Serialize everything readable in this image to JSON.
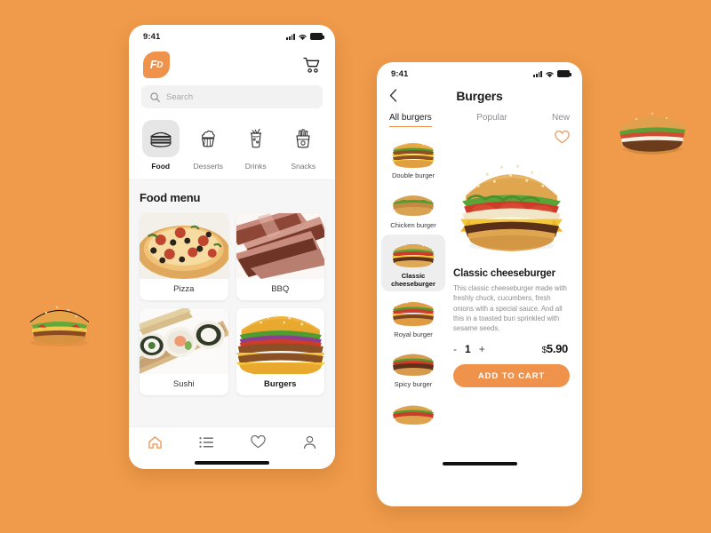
{
  "theme": {
    "background": "#f09b4b",
    "accent": "#ef924b",
    "card": "#ffffff",
    "muted": "#8e8e93"
  },
  "left_phone": {
    "status": {
      "time": "9:41",
      "signal_icon": "signal-bars-icon",
      "wifi_icon": "wifi-icon",
      "battery_icon": "battery-icon"
    },
    "brand": {
      "logo_main": "F",
      "logo_sub": "D",
      "cart_icon": "shopping-cart-icon"
    },
    "search": {
      "placeholder": "Search",
      "value": "",
      "icon": "search-icon"
    },
    "categories": [
      {
        "label": "Food",
        "icon": "burger-icon",
        "active": true
      },
      {
        "label": "Desserts",
        "icon": "cupcake-icon",
        "active": false
      },
      {
        "label": "Drinks",
        "icon": "drink-icon",
        "active": false
      },
      {
        "label": "Snacks",
        "icon": "fries-icon",
        "active": false
      }
    ],
    "menu": {
      "title": "Food menu",
      "cards": [
        {
          "label": "Pizza",
          "image": "pizza-photo",
          "selected": false
        },
        {
          "label": "BBQ",
          "image": "bbq-ribs-photo",
          "selected": false
        },
        {
          "label": "Sushi",
          "image": "sushi-photo",
          "selected": false
        },
        {
          "label": "Burgers",
          "image": "burger-photo",
          "selected": true
        }
      ]
    },
    "bottom_nav": [
      {
        "icon": "home-icon",
        "active": true
      },
      {
        "icon": "list-icon",
        "active": false
      },
      {
        "icon": "heart-icon",
        "active": false
      },
      {
        "icon": "profile-icon",
        "active": false
      }
    ]
  },
  "right_phone": {
    "status": {
      "time": "9:41",
      "signal_icon": "signal-bars-icon",
      "wifi_icon": "wifi-icon",
      "battery_icon": "battery-icon"
    },
    "header": {
      "back_icon": "chevron-left-icon",
      "title": "Burgers"
    },
    "tabs": [
      {
        "label": "All burgers",
        "active": true
      },
      {
        "label": "Popular",
        "active": false
      },
      {
        "label": "New",
        "active": false
      }
    ],
    "burger_list": [
      {
        "name": "Double burger",
        "selected": false
      },
      {
        "name": "Chicken burger",
        "selected": false
      },
      {
        "name": "Classic cheeseburger",
        "selected": true
      },
      {
        "name": "Royal burger",
        "selected": false
      },
      {
        "name": "Spicy burger",
        "selected": false
      },
      {
        "name": "",
        "selected": false
      }
    ],
    "detail": {
      "favorite_icon": "heart-outline-icon",
      "hero_image": "classic-cheeseburger-photo",
      "title": "Classic cheeseburger",
      "description": "This classic cheeseburger made with freshly chuck, cucumbers, fresh onions with a special sauce. And all this in a toasted bun sprinkled with sesame seeds.",
      "minus": "-",
      "quantity": "1",
      "plus": "+",
      "currency": "$",
      "price": "5.90",
      "add_to_cart_label": "ADD TO CART"
    }
  },
  "decor": [
    {
      "name": "floating-burger-left",
      "image": "cheeseburger-photo"
    },
    {
      "name": "floating-burger-right",
      "image": "long-burger-photo"
    }
  ]
}
